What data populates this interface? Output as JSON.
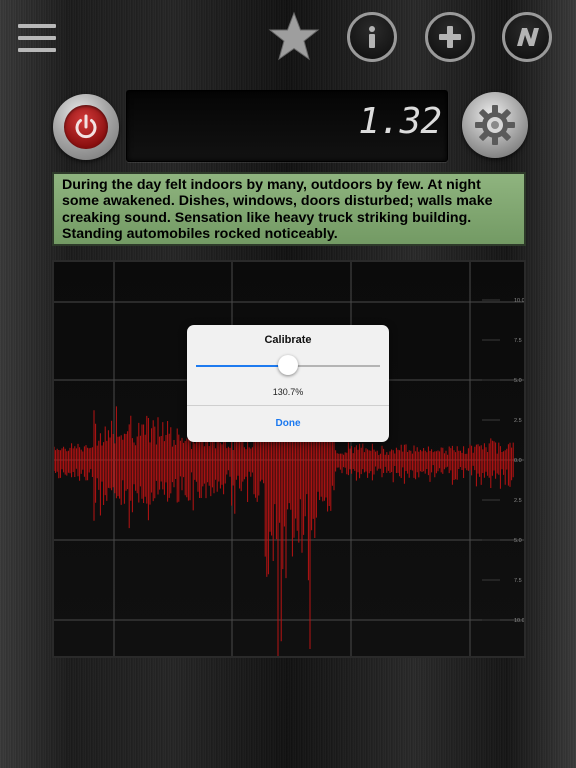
{
  "toolbar": {
    "menu_icon": "hamburger-icon",
    "favorite_icon": "star-icon",
    "info_icon": "info-icon",
    "add_icon": "plus-icon",
    "brand_icon": "n-logo-icon"
  },
  "meter": {
    "power_icon": "power-icon",
    "value": "1.32",
    "settings_icon": "gear-icon"
  },
  "description": "During the day felt indoors by many, outdoors by few. At night some awakened. Dishes, windows, doors disturbed; walls make creaking sound. Sensation like heavy truck striking building. Standing automobiles rocked noticeably.",
  "graph": {
    "y_tick_labels": [
      "10.0",
      "7.5",
      "5.0",
      "2.5",
      "0.0",
      "2.5",
      "5.0",
      "7.5",
      "10.0"
    ],
    "trace_color": "#b81313",
    "grid_color": "#4a4a4a"
  },
  "calibrate_dialog": {
    "title": "Calibrate",
    "slider_fraction": 0.5,
    "value_text": "130.7%",
    "done_label": "Done",
    "accent_color": "#1e7bf0"
  }
}
